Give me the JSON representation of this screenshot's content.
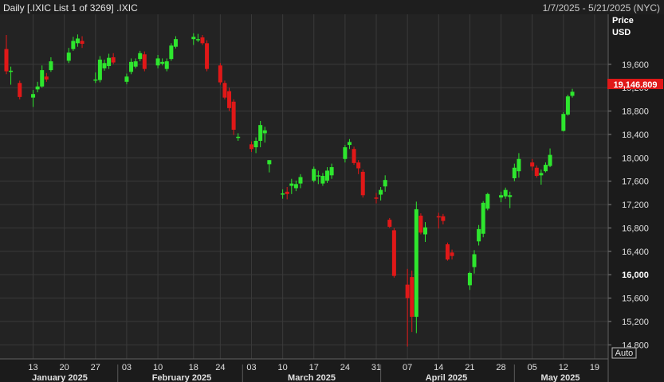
{
  "header": {
    "title": "Daily [.IXIC List 1 of 3269] .IXIC",
    "date_range": "1/7/2025 - 5/21/2025 (NYC)"
  },
  "axis": {
    "price_label": "Price",
    "unit_label": "USD",
    "auto_label": "Auto",
    "last_price_label": "19,146.809"
  },
  "colors": {
    "up": "#2ee62e",
    "down": "#e01818",
    "background": "#232323",
    "grid": "#3a3a3a"
  },
  "chart_data": {
    "type": "candlestick",
    "title": "",
    "y_range": [
      14600,
      20400
    ],
    "y_ticks": [
      14800,
      15200,
      15600,
      16000,
      16400,
      16800,
      17200,
      17600,
      18000,
      18400,
      18800,
      19200,
      19600
    ],
    "highlighted_tick": 16000,
    "last_price": 19146.809,
    "x_ticks": [
      "13",
      "20",
      "27",
      "03",
      "10",
      "18",
      "24",
      "03",
      "10",
      "17",
      "24",
      "31",
      "07",
      "14",
      "21",
      "28",
      "05",
      "12",
      "19"
    ],
    "months": [
      "January 2025",
      "February 2025",
      "March 2025",
      "April 2025",
      "May 2025"
    ],
    "dates": [
      "2025-01-07",
      "2025-01-08",
      "2025-01-10",
      "2025-01-13",
      "2025-01-14",
      "2025-01-15",
      "2025-01-16",
      "2025-01-17",
      "2025-01-21",
      "2025-01-22",
      "2025-01-23",
      "2025-01-24",
      "2025-01-27",
      "2025-01-28",
      "2025-01-29",
      "2025-01-30",
      "2025-01-31",
      "2025-02-03",
      "2025-02-04",
      "2025-02-05",
      "2025-02-06",
      "2025-02-07",
      "2025-02-10",
      "2025-02-11",
      "2025-02-12",
      "2025-02-13",
      "2025-02-14",
      "2025-02-18",
      "2025-02-19",
      "2025-02-20",
      "2025-02-21",
      "2025-02-24",
      "2025-02-25",
      "2025-02-26",
      "2025-02-27",
      "2025-02-28",
      "2025-03-03",
      "2025-03-04",
      "2025-03-05",
      "2025-03-06",
      "2025-03-07",
      "2025-03-10",
      "2025-03-11",
      "2025-03-12",
      "2025-03-13",
      "2025-03-14",
      "2025-03-17",
      "2025-03-18",
      "2025-03-19",
      "2025-03-20",
      "2025-03-21",
      "2025-03-24",
      "2025-03-25",
      "2025-03-26",
      "2025-03-27",
      "2025-03-28",
      "2025-03-31",
      "2025-04-01",
      "2025-04-02",
      "2025-04-03",
      "2025-04-04",
      "2025-04-07",
      "2025-04-08",
      "2025-04-09",
      "2025-04-10",
      "2025-04-11",
      "2025-04-14",
      "2025-04-15",
      "2025-04-16",
      "2025-04-17",
      "2025-04-21",
      "2025-04-22",
      "2025-04-23",
      "2025-04-24",
      "2025-04-25",
      "2025-04-28",
      "2025-04-29",
      "2025-04-30",
      "2025-05-01",
      "2025-05-02",
      "2025-05-05",
      "2025-05-06",
      "2025-05-07",
      "2025-05-08",
      "2025-05-09",
      "2025-05-12",
      "2025-05-13",
      "2025-05-14"
    ],
    "open": [
      19860,
      19480,
      19280,
      19030,
      19170,
      19220,
      19390,
      19500,
      19660,
      19860,
      19960,
      20000,
      19320,
      19330,
      19530,
      19570,
      19720,
      19300,
      19470,
      19560,
      19690,
      19770,
      19580,
      19610,
      19520,
      19690,
      19900,
      20030,
      20020,
      20060,
      19960,
      19580,
      19280,
      19140,
      18960,
      18360,
      18230,
      18180,
      18290,
      18420,
      17890,
      17380,
      17420,
      17520,
      17480,
      17560,
      17610,
      17700,
      17560,
      17610,
      17700,
      17980,
      18220,
      18150,
      17920,
      17760,
      17320,
      17370,
      17510,
      16940,
      16760,
      15830,
      15960,
      15280,
      17010,
      16690,
      17000,
      17000,
      16520,
      16380,
      15820,
      16130,
      16570,
      16700,
      17130,
      17320,
      17340,
      17330,
      17650,
      17770,
      17920,
      17830,
      17700,
      17770,
      17860,
      18460,
      18740,
      19060
    ],
    "close": [
      19480,
      19490,
      19040,
      19090,
      19220,
      19500,
      19340,
      19650,
      19800,
      20000,
      20040,
      19950,
      19340,
      19680,
      19620,
      19710,
      19630,
      19390,
      19640,
      19650,
      19790,
      19520,
      19700,
      19640,
      19650,
      19920,
      20030,
      20070,
      20030,
      19960,
      19520,
      19290,
      19030,
      18850,
      18480,
      18360,
      18150,
      18290,
      18560,
      18470,
      17960,
      17390,
      17380,
      17560,
      17550,
      17670,
      17810,
      17700,
      17690,
      17780,
      17840,
      18180,
      18270,
      17910,
      17820,
      17360,
      17300,
      17450,
      17620,
      16820,
      15980,
      15600,
      15280,
      17120,
      16720,
      16810,
      16980,
      16920,
      16260,
      16320,
      16030,
      16350,
      16780,
      17230,
      17380,
      17360,
      17450,
      17360,
      17830,
      17980,
      17850,
      17690,
      17740,
      17880,
      18050,
      18750,
      19050,
      19130
    ],
    "high": [
      20100,
      19560,
      19320,
      19160,
      19300,
      19580,
      19450,
      19720,
      19880,
      20070,
      20110,
      20080,
      19460,
      19740,
      19680,
      19780,
      19790,
      19440,
      19700,
      19700,
      19830,
      19820,
      19760,
      19700,
      19700,
      19960,
      20080,
      20130,
      20120,
      20100,
      20010,
      19620,
      19320,
      19200,
      19000,
      18420,
      18280,
      18350,
      18630,
      18530,
      17960,
      17460,
      17500,
      17640,
      17610,
      17720,
      17850,
      17780,
      17740,
      17840,
      17900,
      18220,
      18320,
      18190,
      17960,
      17800,
      17400,
      17500,
      17700,
      16970,
      16800,
      16100,
      16070,
      17250,
      17050,
      16900,
      17060,
      17040,
      16550,
      16430,
      16050,
      16420,
      16850,
      17260,
      17400,
      17420,
      17490,
      17420,
      17900,
      18080,
      17980,
      17870,
      17800,
      17920,
      18160,
      18780,
      19080,
      19180
    ],
    "low": [
      19430,
      19250,
      19000,
      18870,
      19120,
      19200,
      19300,
      19470,
      19620,
      19830,
      19900,
      19880,
      19280,
      19290,
      19490,
      19520,
      19600,
      19260,
      19430,
      19530,
      19650,
      19480,
      19530,
      19580,
      19480,
      19660,
      19870,
      19930,
      19980,
      19930,
      19480,
      19250,
      19000,
      18800,
      18390,
      18290,
      18100,
      18080,
      18180,
      18260,
      17750,
      17300,
      17290,
      17380,
      17430,
      17480,
      17580,
      17550,
      17520,
      17570,
      17640,
      17920,
      18150,
      17880,
      17720,
      17320,
      17220,
      17270,
      17420,
      16800,
      15950,
      14770,
      15020,
      15000,
      16690,
      16560,
      16790,
      16860,
      16240,
      16260,
      15740,
      16020,
      16500,
      16640,
      17100,
      17240,
      17300,
      17140,
      17600,
      17660,
      17780,
      17660,
      17540,
      17750,
      17840,
      18450,
      18720,
      19030
    ]
  }
}
